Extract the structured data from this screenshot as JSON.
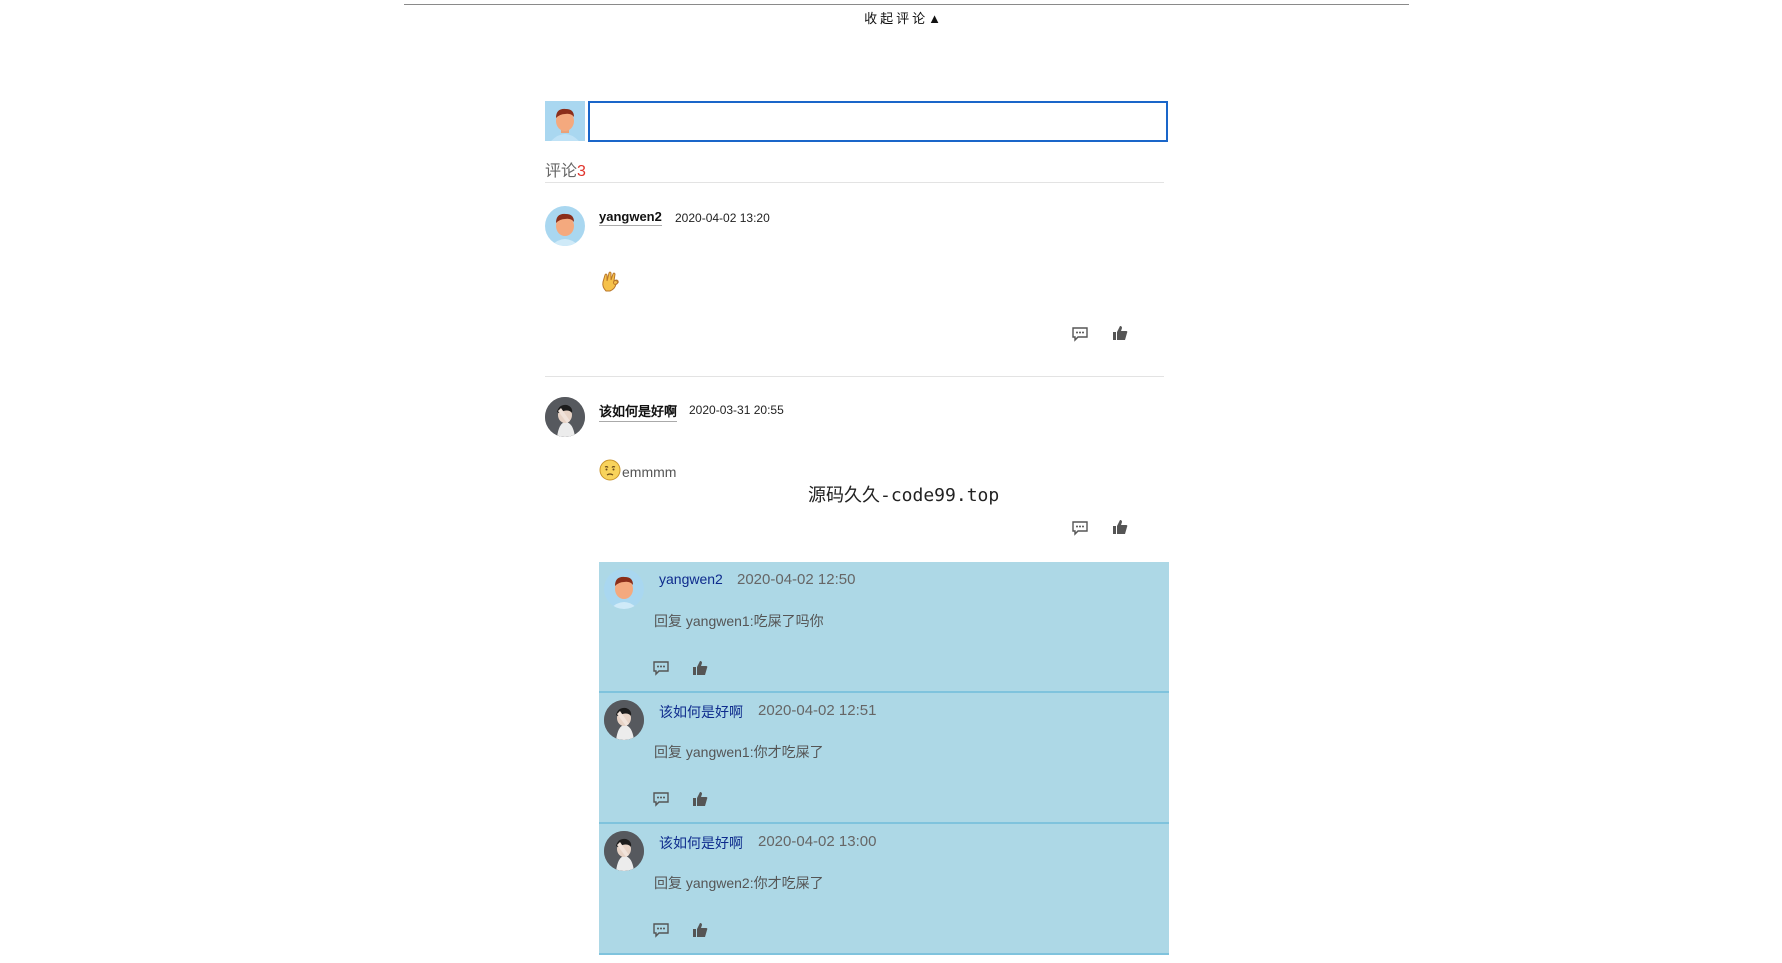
{
  "header": {
    "collapse_label": "收起评论▲"
  },
  "composer": {
    "placeholder": ""
  },
  "comments_header": {
    "label": "评论",
    "count": "3"
  },
  "comments": [
    {
      "user": "yangwen2",
      "time": "2020-04-02 13:20",
      "emoji": "ok-hand-icon",
      "text": ""
    },
    {
      "user": "该如何是好啊",
      "time": "2020-03-31 20:55",
      "emoji": "pensive-face-icon",
      "text": "emmmm",
      "replies": [
        {
          "user": "yangwen2",
          "time": "2020-04-02 12:50",
          "text": "回复 yangwen1:吃屎了吗你"
        },
        {
          "user": "该如何是好啊",
          "time": "2020-04-02 12:51",
          "text": "回复 yangwen1:你才吃屎了"
        },
        {
          "user": "该如何是好啊",
          "time": "2020-04-02 13:00",
          "text": "回复 yangwen2:你才吃屎了"
        }
      ]
    }
  ],
  "watermark": "源码久久-code99.top",
  "colors": {
    "accent": "#1a66c9",
    "reply_bg": "#add8e6",
    "count": "#e0332b",
    "reply_user": "#0d2a8c"
  }
}
